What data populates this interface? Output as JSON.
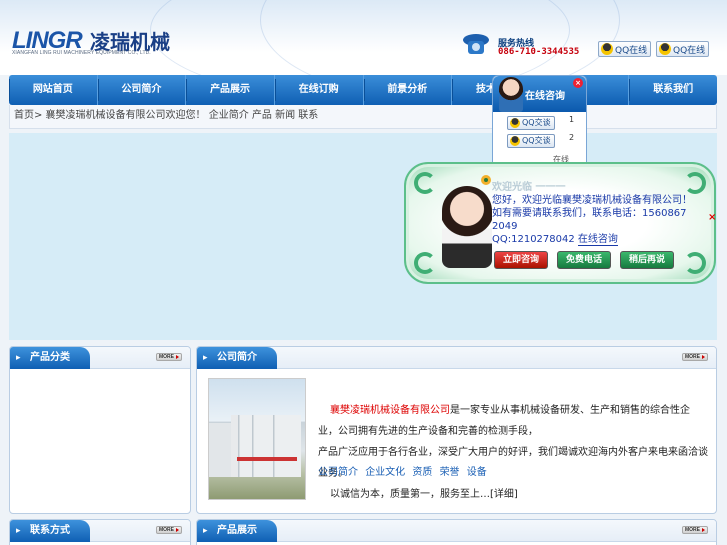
{
  "header": {
    "logo_en": "LINGR",
    "logo_cn": "凌瑞机械",
    "logo_sub": "XIANGFAN LING RUI MACHINERY EQUIPMENT CO., LTD.",
    "hotline_label": "服务热线",
    "hotline_number": "086-710-3344535",
    "qq_buttons": [
      "QQ在线",
      "QQ在线"
    ]
  },
  "nav": {
    "items": [
      "网站首页",
      "公司简介",
      "产品展示",
      "在线订购",
      "前景分析",
      "技术支持",
      "",
      "联系我们"
    ]
  },
  "breadcrumb": "首页> 襄樊凌瑞机械设备有限公司欢迎您！ 企业简介 产品 新闻 联系",
  "panels": {
    "left_title": "产品分类",
    "main_title": "公司简介",
    "left2_title": "联系方式",
    "main2_title": "产品展示",
    "more_label": "MORE"
  },
  "about": {
    "highlight": "襄樊凌瑞机械设备有限公司",
    "line1": "是一家专业从事机械设备研发、生产和销售的综合性企业，公司拥有先进的生产设备和完善的检测手段，",
    "line2": "产品广泛应用于各行各业，深受广大用户的好评，我们竭诚欢迎海内外客户来电来函洽谈业务。",
    "line3": "以诚信为本，质量第一，服务至上…",
    "detail_link": "[详细]",
    "links": [
      "公司简介",
      "企业文化",
      "资质",
      "荣誉",
      "设备"
    ]
  },
  "chat_float": {
    "title": "在线咨询",
    "close": "×",
    "qq_label": "QQ交谈",
    "rows": [
      "1",
      "2"
    ],
    "online": "在线"
  },
  "invite": {
    "title": "欢迎光临 一一一",
    "text": "您好，欢迎光临襄樊凌瑞机械设备有限公司！如有需要请联系我们，联系电话：15608672049",
    "qq_line": "QQ:1210278042",
    "qq_tail": "在线咨询",
    "close": "×",
    "btn_consult": "立即咨询",
    "btn_call": "免费电话",
    "btn_later": "稍后再说"
  },
  "colors": {
    "nav_blue": "#1f74c7",
    "accent_red": "#d00000",
    "link_blue": "#1a5fb4",
    "popup_green": "#5cbf8a"
  }
}
